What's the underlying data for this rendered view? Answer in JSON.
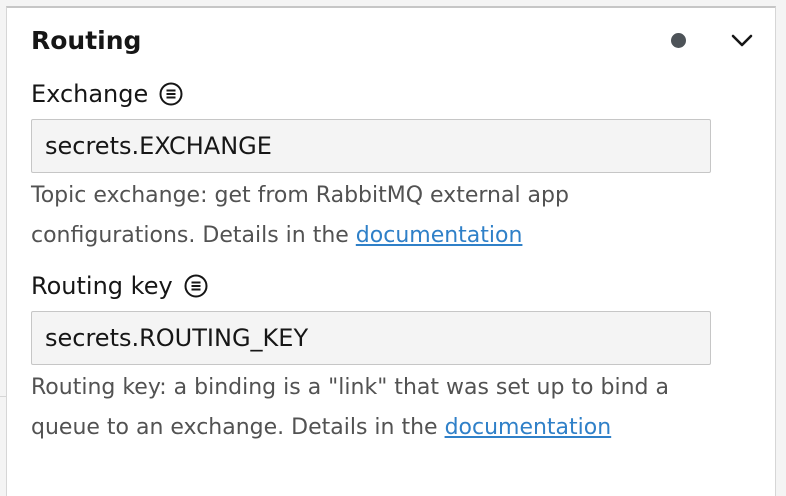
{
  "section": {
    "title": "Routing",
    "status_icon": "dot-icon",
    "collapse_icon": "chevron-down-icon"
  },
  "exchange": {
    "label": "Exchange",
    "label_icon": "variable-icon",
    "value": "secrets.EXCHANGE",
    "help_text": "Topic exchange: get from RabbitMQ external app configurations. Details in the",
    "help_link": "documentation"
  },
  "routing_key": {
    "label": "Routing key",
    "label_icon": "variable-icon",
    "value": "secrets.ROUTING_KEY",
    "help_text": "Routing key: a binding is a \"link\" that was set up to bind a queue to an exchange. Details in the",
    "help_link": "documentation"
  },
  "colors": {
    "link": "#2f80c8",
    "status_dot": "#4d5358",
    "input_bg": "#f4f4f4"
  }
}
